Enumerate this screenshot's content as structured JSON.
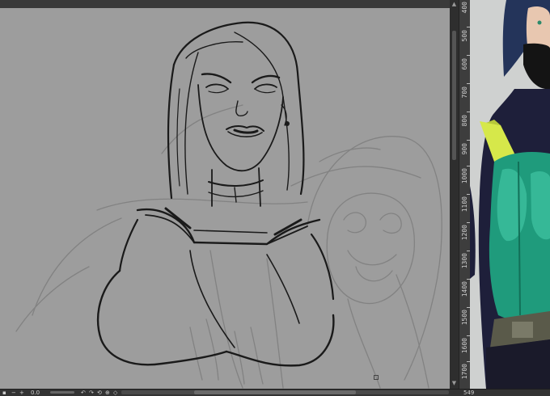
{
  "window": {
    "title": ""
  },
  "ruler": {
    "labels": [
      "400",
      "500",
      "600",
      "700",
      "800",
      "900",
      "1000",
      "1100",
      "1200",
      "1300",
      "1400",
      "1500",
      "1600",
      "1700"
    ]
  },
  "status_bar": {
    "zoom_value": "0.0",
    "corner_value": "549",
    "icons": [
      "rotate-left-icon",
      "rotate-right-icon",
      "reset-icon",
      "add-icon",
      "fit-icon"
    ]
  },
  "colors": {
    "canvas_bg": "#9d9d9d",
    "ui_dark": "#2b2b2b",
    "ruler_bg": "#3d3d3d",
    "ref_teal": "#1f9b7c",
    "ref_yellow": "#d6e84a",
    "ref_navy": "#1e1f3a"
  }
}
